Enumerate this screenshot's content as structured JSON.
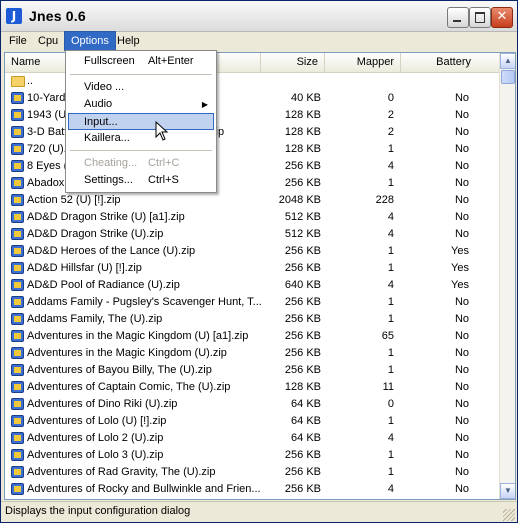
{
  "window": {
    "icon_letter": "J",
    "title": "Jnes 0.6",
    "close_glyph": "✕"
  },
  "menubar": {
    "items": [
      {
        "label": "File"
      },
      {
        "label": "Cpu"
      },
      {
        "label": "Options"
      },
      {
        "label": "Help"
      }
    ]
  },
  "options_menu": {
    "items": [
      {
        "label": "Fullscreen",
        "shortcut": "Alt+Enter"
      },
      {
        "label": "Video ..."
      },
      {
        "label": "Audio",
        "arrow": "▶"
      },
      {
        "label": "Input..."
      },
      {
        "label": "Kaillera..."
      },
      {
        "label": "Cheating...",
        "shortcut": "Ctrl+C"
      },
      {
        "label": "Settings...",
        "shortcut": "Ctrl+S"
      }
    ]
  },
  "list": {
    "columns": {
      "name": "Name",
      "size": "Size",
      "mapper": "Mapper",
      "battery": "Battery"
    },
    "rows": [
      {
        "name": "..",
        "size": "",
        "mapper": "",
        "battery": ""
      },
      {
        "name": "10-Yard Fight (U).zip",
        "size": "40 KB",
        "mapper": "0",
        "battery": "No"
      },
      {
        "name": "1943 (U).zip",
        "size": "128 KB",
        "mapper": "2",
        "battery": "No"
      },
      {
        "name": "3-D Battles of World Runner, The (U).zip",
        "size": "128 KB",
        "mapper": "2",
        "battery": "No"
      },
      {
        "name": "720 (U).zip",
        "size": "128 KB",
        "mapper": "1",
        "battery": "No"
      },
      {
        "name": "8 Eyes (U).zip",
        "size": "256 KB",
        "mapper": "4",
        "battery": "No"
      },
      {
        "name": "Abadox (U).zip",
        "size": "256 KB",
        "mapper": "1",
        "battery": "No"
      },
      {
        "name": "Action 52 (U) [!].zip",
        "size": "2048 KB",
        "mapper": "228",
        "battery": "No"
      },
      {
        "name": "AD&D Dragon Strike (U) [a1].zip",
        "size": "512 KB",
        "mapper": "4",
        "battery": "No"
      },
      {
        "name": "AD&D Dragon Strike (U).zip",
        "size": "512 KB",
        "mapper": "4",
        "battery": "No"
      },
      {
        "name": "AD&D Heroes of the Lance (U).zip",
        "size": "256 KB",
        "mapper": "1",
        "battery": "Yes"
      },
      {
        "name": "AD&D Hillsfar (U) [!].zip",
        "size": "256 KB",
        "mapper": "1",
        "battery": "Yes"
      },
      {
        "name": "AD&D Pool of Radiance (U).zip",
        "size": "640 KB",
        "mapper": "4",
        "battery": "Yes"
      },
      {
        "name": "Addams Family - Pugsley's Scavenger Hunt, T...",
        "size": "256 KB",
        "mapper": "1",
        "battery": "No"
      },
      {
        "name": "Addams Family, The (U).zip",
        "size": "256 KB",
        "mapper": "1",
        "battery": "No"
      },
      {
        "name": "Adventures in the Magic Kingdom (U) [a1].zip",
        "size": "256 KB",
        "mapper": "65",
        "battery": "No"
      },
      {
        "name": "Adventures in the Magic Kingdom (U).zip",
        "size": "256 KB",
        "mapper": "1",
        "battery": "No"
      },
      {
        "name": "Adventures of Bayou Billy, The (U).zip",
        "size": "256 KB",
        "mapper": "1",
        "battery": "No"
      },
      {
        "name": "Adventures of Captain Comic, The (U).zip",
        "size": "128 KB",
        "mapper": "11",
        "battery": "No"
      },
      {
        "name": "Adventures of Dino Riki (U).zip",
        "size": "64 KB",
        "mapper": "0",
        "battery": "No"
      },
      {
        "name": "Adventures of Lolo (U) [!].zip",
        "size": "64 KB",
        "mapper": "1",
        "battery": "No"
      },
      {
        "name": "Adventures of Lolo 2 (U).zip",
        "size": "64 KB",
        "mapper": "4",
        "battery": "No"
      },
      {
        "name": "Adventures of Lolo 3 (U).zip",
        "size": "256 KB",
        "mapper": "1",
        "battery": "No"
      },
      {
        "name": "Adventures of Rad Gravity, The (U).zip",
        "size": "256 KB",
        "mapper": "1",
        "battery": "No"
      },
      {
        "name": "Adventures of Rocky and Bullwinkle and Frien...",
        "size": "256 KB",
        "mapper": "4",
        "battery": "No"
      }
    ]
  },
  "scrollbar": {
    "up_glyph": "▲",
    "down_glyph": "▼"
  },
  "status": {
    "text": "Displays the input configuration dialog"
  }
}
